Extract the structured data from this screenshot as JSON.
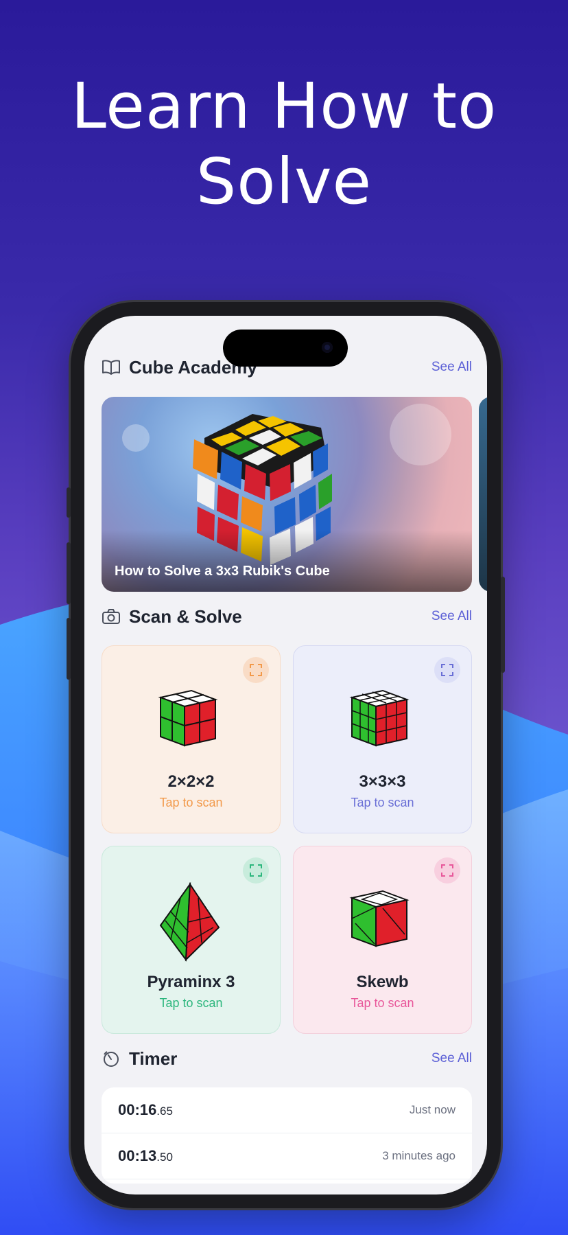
{
  "headline": {
    "line1": "Learn How to",
    "line2": "Solve"
  },
  "academy": {
    "title": "Cube Academy",
    "see_all": "See All",
    "icon": "book-icon",
    "card_caption": "How to Solve a 3x3 Rubik's Cube"
  },
  "scan": {
    "title": "Scan & Solve",
    "see_all": "See All",
    "icon": "camera-icon",
    "items": [
      {
        "name": "2×2×2",
        "tap": "Tap to scan",
        "accent": "#f2994a"
      },
      {
        "name": "3×3×3",
        "tap": "Tap to scan",
        "accent": "#6a6fd6"
      },
      {
        "name": "Pyraminx 3",
        "tap": "Tap to scan",
        "accent": "#2cb67d"
      },
      {
        "name": "Skewb",
        "tap": "Tap to scan",
        "accent": "#e8579a"
      }
    ]
  },
  "timer": {
    "title": "Timer",
    "see_all": "See All",
    "icon": "stopwatch-icon",
    "rows": [
      {
        "main": "00:16",
        "frac": ".65",
        "ago": "Just now"
      },
      {
        "main": "00:13",
        "frac": ".50",
        "ago": "3 minutes ago"
      }
    ]
  }
}
